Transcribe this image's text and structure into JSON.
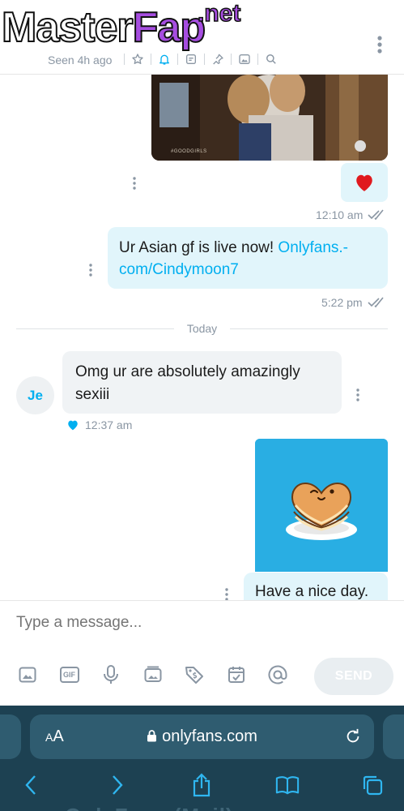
{
  "header": {
    "watermark_part1": "Master",
    "watermark_part2": "Fap",
    "watermark_net": ".net",
    "seen": "Seen 4h ago",
    "icons": [
      "star-icon",
      "bell-icon",
      "note-icon",
      "pin-icon",
      "image-icon",
      "search-icon"
    ]
  },
  "messages": {
    "top_image_caption": "#GOODGIRLS",
    "heart_time": "12:10 am",
    "promo_text": "Ur Asian gf is live now! ",
    "promo_link": "Onlyfans.-com/Cindymoon7",
    "promo_time": "5:22 pm",
    "day_separator": "Today",
    "incoming_avatar": "Je",
    "incoming_text": "Omg ur are absolutely amazingly sexiii",
    "incoming_time": "12:37 am",
    "outgoing_text": "Have a nice day."
  },
  "composer": {
    "placeholder": "Type a message...",
    "send_label": "SEND",
    "tools": [
      "image-icon",
      "gif-icon",
      "microphone-icon",
      "media-vault-icon",
      "price-tag-icon",
      "schedule-icon",
      "mention-icon"
    ],
    "gif_label": "GIF"
  },
  "browser": {
    "aa_label": "AA",
    "url": "onlyfans.com",
    "ghost_text": "OnlyFans (Mail)"
  },
  "colors": {
    "accent": "#00aff0",
    "outgoing_bubble": "#e1f5fb",
    "incoming_bubble": "#f0f3f5",
    "safari_bg": "#1d4152",
    "heart": "#e0191e"
  }
}
